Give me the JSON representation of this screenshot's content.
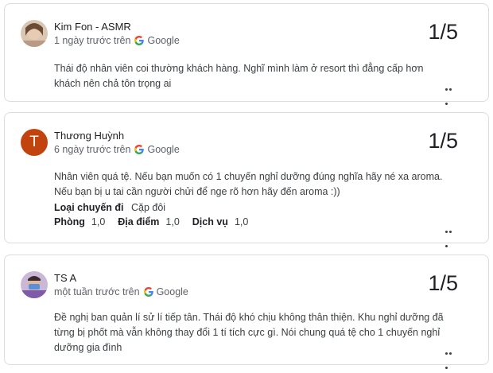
{
  "reviews": [
    {
      "author": "Kim Fon - ASMR",
      "time": "1 ngày trước trên",
      "source": "Google",
      "rating": "1/5",
      "text": "Thái độ nhân viên coi thường khách hàng. Nghĩ mình làm ở resort thì đẳng cấp hơn khách nên chả tôn trọng ai",
      "avatar": "photo"
    },
    {
      "author": "Thương Huỳnh",
      "time": "6 ngày trước trên",
      "source": "Google",
      "rating": "1/5",
      "text": "Nhân viên quá tệ. Nếu bạn muốn có 1 chuyến nghỉ dưỡng đúng nghĩa hãy né xa aroma. Nếu bạn bị u tai cần người chửi để nge rõ hơn hãy đến aroma :))",
      "avatar": "T",
      "avatar_color": "#c1440e",
      "trip_label": "Loại chuyến đi",
      "trip_value": "Cặp đôi",
      "subratings": [
        {
          "label": "Phòng",
          "value": "1,0"
        },
        {
          "label": "Địa điểm",
          "value": "1,0"
        },
        {
          "label": "Dịch vụ",
          "value": "1,0"
        }
      ]
    },
    {
      "author": "TS A",
      "time": "một tuần trước trên",
      "source": "Google",
      "rating": "1/5",
      "text": "Đề nghị ban quản lí sử lí tiếp tân. Thái độ khó chịu không thân thiện. Khu nghỉ dưỡng đã từng bị phốt mà vẫn không thay đổi 1 tí tích cực gì. Nói chung quá tệ cho 1 chuyến nghỉ dưỡng gia đình",
      "avatar": "photo"
    }
  ],
  "icons": {
    "google": "google-g-icon",
    "more": "more-options-icon"
  },
  "colors": {
    "border": "#dadce0",
    "secondary_text": "#5f6368",
    "avatar_t": "#c1440e"
  }
}
